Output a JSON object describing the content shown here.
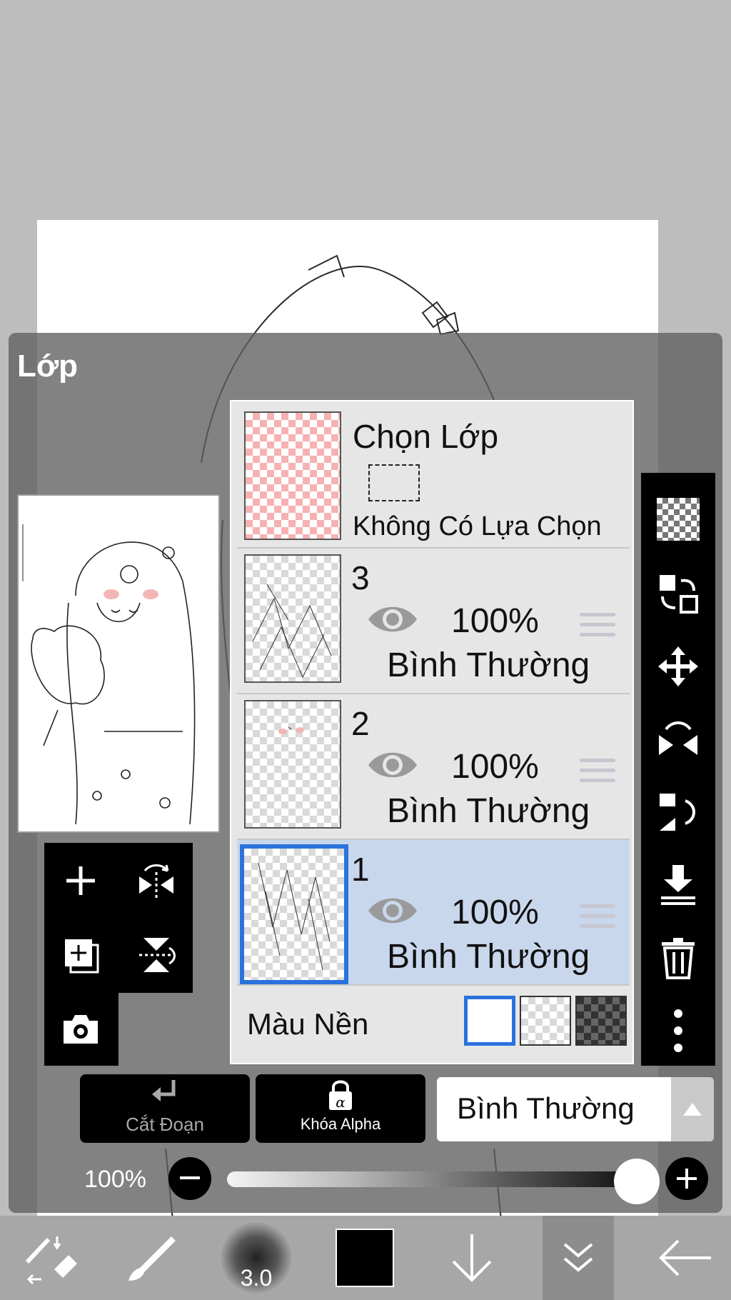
{
  "panel": {
    "title": "Lớp"
  },
  "selection_row": {
    "title": "Chọn Lớp",
    "status": "Không Có Lựa Chọn"
  },
  "layers": [
    {
      "name": "3",
      "opacity": "100%",
      "blend_mode": "Bình Thường",
      "selected": false
    },
    {
      "name": "2",
      "opacity": "100%",
      "blend_mode": "Bình Thường",
      "selected": false
    },
    {
      "name": "1",
      "opacity": "100%",
      "blend_mode": "Bình Thường",
      "selected": true
    }
  ],
  "background": {
    "label": "Màu Nền",
    "options": [
      "white",
      "transparent",
      "dark-checker"
    ],
    "selected": "white"
  },
  "buttons": {
    "clipping_label": "Cắt Đoạn",
    "alpha_lock_label": "Khóa Alpha"
  },
  "blend_mode_select": {
    "value": "Bình Thường"
  },
  "opacity_slider": {
    "label": "100%",
    "value_percent": 100
  },
  "toolbar": {
    "brush_size": "3.0",
    "current_color": "#000000"
  },
  "colors": {
    "accent": "#2a72de",
    "selected_row": "#c9d7ec",
    "panel_bg": "#5f5f5f"
  }
}
